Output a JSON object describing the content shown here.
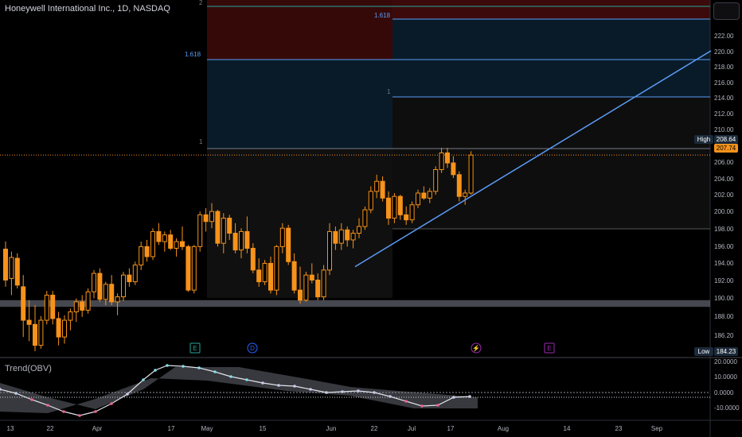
{
  "header": {
    "symbol_title": "Honeywell International Inc., 1D, NASDAQ"
  },
  "indicator": {
    "label": "Trend(OBV)"
  },
  "price_axis": {
    "ticks": [
      "222.00",
      "220.00",
      "218.00",
      "216.00",
      "214.00",
      "212.00",
      "210.00",
      "206.00",
      "204.00",
      "202.00",
      "200.00",
      "198.00",
      "196.00",
      "194.00",
      "192.00",
      "190.00",
      "188.00",
      "186.20"
    ],
    "high_tag": "High",
    "high_value": "208.64",
    "last_value": "207.74",
    "low_tag": "Low",
    "low_value": "184.23"
  },
  "osc_axis": {
    "ticks": [
      "20.0000",
      "10.0000",
      "0.0000",
      "-10.0000"
    ]
  },
  "time_axis": {
    "ticks": [
      "13",
      "22",
      "Apr",
      "17",
      "May",
      "15",
      "Jun",
      "22",
      "Jul",
      "17",
      "Aug",
      "14",
      "23",
      "Sep"
    ]
  },
  "fib": {
    "left": [
      "2",
      "1.618",
      "1"
    ],
    "right": [
      "1.618",
      "1"
    ]
  },
  "events": [
    "E",
    "D",
    "⚡",
    "E"
  ],
  "colors": {
    "up": "#f7931a",
    "down": "#f7931a",
    "line": "#5b9cf6",
    "bg": "#000000"
  },
  "chart_data": {
    "type": "candlestick",
    "ylim": [
      183.5,
      224.5
    ],
    "candles_ohlc": [
      [
        196.5,
        197.4,
        192.0,
        192.8
      ],
      [
        193.0,
        196.2,
        191.0,
        195.5
      ],
      [
        195.4,
        196.0,
        191.8,
        192.2
      ],
      [
        192.0,
        193.4,
        186.0,
        188.0
      ],
      [
        188.0,
        190.4,
        185.5,
        187.5
      ],
      [
        187.5,
        189.8,
        184.3,
        185.0
      ],
      [
        185.0,
        188.5,
        184.6,
        188.0
      ],
      [
        188.0,
        191.5,
        187.5,
        191.0
      ],
      [
        191.0,
        191.5,
        187.5,
        188.2
      ],
      [
        188.2,
        189.0,
        185.0,
        186.0
      ],
      [
        186.0,
        188.6,
        185.2,
        188.0
      ],
      [
        188.0,
        189.4,
        186.8,
        189.0
      ],
      [
        189.0,
        190.6,
        187.8,
        190.2
      ],
      [
        190.2,
        191.0,
        188.4,
        189.2
      ],
      [
        189.2,
        191.8,
        188.8,
        191.4
      ],
      [
        191.4,
        194.0,
        190.6,
        193.6
      ],
      [
        193.6,
        194.2,
        190.2,
        190.5
      ],
      [
        190.5,
        192.6,
        189.8,
        192.3
      ],
      [
        192.3,
        193.4,
        189.8,
        190.2
      ],
      [
        190.2,
        191.2,
        188.6,
        190.8
      ],
      [
        190.8,
        193.8,
        190.3,
        193.4
      ],
      [
        193.4,
        194.2,
        192.0,
        192.6
      ],
      [
        192.6,
        195.0,
        192.2,
        194.6
      ],
      [
        194.6,
        197.4,
        194.0,
        196.8
      ],
      [
        196.8,
        197.6,
        195.0,
        195.6
      ],
      [
        195.6,
        199.0,
        195.2,
        198.6
      ],
      [
        198.6,
        199.6,
        197.0,
        197.4
      ],
      [
        197.4,
        198.6,
        196.2,
        198.2
      ],
      [
        198.2,
        198.8,
        196.4,
        196.6
      ],
      [
        196.6,
        197.8,
        195.6,
        197.4
      ],
      [
        197.4,
        199.2,
        196.4,
        196.8
      ],
      [
        196.8,
        197.0,
        191.4,
        191.6
      ],
      [
        191.6,
        197.0,
        191.2,
        196.8
      ],
      [
        196.8,
        201.0,
        196.2,
        200.6
      ],
      [
        200.6,
        201.4,
        198.6,
        199.8
      ],
      [
        199.8,
        202.0,
        199.0,
        201.0
      ],
      [
        201.0,
        201.2,
        196.8,
        197.2
      ],
      [
        197.2,
        200.8,
        196.0,
        200.2
      ],
      [
        200.2,
        200.6,
        197.6,
        198.4
      ],
      [
        198.4,
        199.6,
        196.0,
        196.4
      ],
      [
        196.4,
        199.0,
        195.4,
        198.6
      ],
      [
        198.6,
        200.4,
        196.0,
        196.6
      ],
      [
        196.6,
        197.2,
        193.6,
        194.0
      ],
      [
        194.0,
        195.4,
        192.0,
        192.6
      ],
      [
        192.6,
        195.2,
        192.2,
        194.8
      ],
      [
        194.8,
        195.6,
        191.2,
        191.6
      ],
      [
        191.6,
        197.0,
        191.0,
        196.8
      ],
      [
        196.8,
        199.6,
        196.0,
        199.0
      ],
      [
        199.0,
        199.4,
        194.6,
        195.0
      ],
      [
        195.0,
        196.0,
        191.2,
        191.6
      ],
      [
        191.6,
        194.4,
        190.0,
        190.4
      ],
      [
        190.4,
        193.8,
        190.2,
        193.4
      ],
      [
        193.4,
        194.8,
        192.4,
        192.8
      ],
      [
        192.8,
        193.6,
        190.4,
        190.8
      ],
      [
        190.8,
        194.6,
        190.4,
        194.0
      ],
      [
        194.0,
        199.6,
        193.4,
        198.6
      ],
      [
        198.6,
        199.2,
        196.4,
        197.2
      ],
      [
        197.2,
        199.6,
        196.4,
        198.8
      ],
      [
        198.8,
        199.2,
        196.8,
        197.6
      ],
      [
        197.6,
        198.8,
        196.6,
        198.4
      ],
      [
        198.4,
        200.2,
        197.8,
        199.2
      ],
      [
        199.2,
        201.6,
        198.8,
        201.2
      ],
      [
        201.2,
        204.0,
        200.8,
        203.4
      ],
      [
        203.4,
        205.4,
        202.6,
        204.6
      ],
      [
        204.6,
        205.2,
        202.2,
        202.6
      ],
      [
        202.6,
        203.4,
        199.4,
        200.2
      ],
      [
        200.2,
        203.2,
        199.6,
        202.8
      ],
      [
        202.8,
        203.0,
        200.0,
        200.6
      ],
      [
        200.6,
        201.6,
        199.4,
        200.0
      ],
      [
        200.0,
        202.2,
        199.6,
        201.8
      ],
      [
        201.8,
        203.6,
        201.4,
        203.2
      ],
      [
        203.2,
        204.0,
        202.4,
        202.6
      ],
      [
        202.6,
        203.8,
        202.0,
        203.4
      ],
      [
        203.4,
        206.4,
        203.0,
        206.0
      ],
      [
        206.0,
        208.6,
        205.6,
        208.0
      ],
      [
        208.0,
        208.6,
        206.2,
        206.8
      ],
      [
        206.8,
        207.6,
        205.0,
        205.4
      ],
      [
        205.4,
        205.8,
        202.2,
        202.8
      ],
      [
        202.8,
        203.6,
        201.8,
        203.2
      ],
      [
        203.2,
        208.2,
        203.0,
        207.74
      ]
    ],
    "trendline": [
      [
        194.4,
        "Jun"
      ],
      [
        220.2,
        "Sep"
      ]
    ],
    "support_zone": [
      189.6,
      190.4
    ]
  }
}
